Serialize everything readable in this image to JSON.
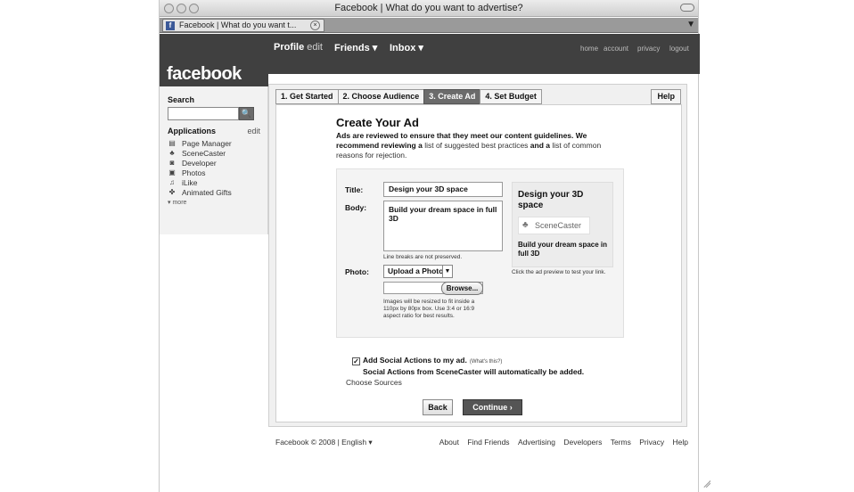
{
  "window": {
    "title": "Facebook | What do you want to advertise?"
  },
  "browser_tab": {
    "label": "Facebook | What do you want t...",
    "favicon": "f"
  },
  "sidebar": {
    "logo": "facebook",
    "search_label": "Search",
    "search_value": "",
    "apps_heading": "Applications",
    "apps_edit": "edit",
    "apps": [
      {
        "label": "Page Manager",
        "icon": "page-manager-icon"
      },
      {
        "label": "SceneCaster",
        "icon": "scenecaster-icon"
      },
      {
        "label": "Developer",
        "icon": "developer-icon"
      },
      {
        "label": "Photos",
        "icon": "photos-icon"
      },
      {
        "label": "iLike",
        "icon": "ilike-icon"
      },
      {
        "label": "Animated Gifts",
        "icon": "animated-gifts-icon"
      }
    ],
    "more": "more"
  },
  "topnav": {
    "profile": "Profile",
    "profile_edit": "edit",
    "friends": "Friends",
    "inbox": "Inbox",
    "home": "home",
    "account": "account",
    "privacy": "privacy",
    "logout": "logout"
  },
  "steps": [
    "1. Get Started",
    "2. Choose Audience",
    "3. Create Ad",
    "4. Set Budget"
  ],
  "active_step": 2,
  "help": "Help",
  "create_ad": {
    "heading": "Create Your Ad",
    "intro_a": "Ads are reviewed to ensure that they meet our content guidelines. We recommend reviewing a ",
    "intro_link1": "list of suggested best practices",
    "intro_b": " and a ",
    "intro_link2": "list of common reasons for rejection.",
    "title_label": "Title:",
    "title_value": "Design your 3D space",
    "body_label": "Body:",
    "body_value": "Build your dream space in full 3D",
    "body_hint": "Line breaks are not preserved.",
    "photo_label": "Photo:",
    "photo_select": "Upload a Photo",
    "browse": "Browse...",
    "photo_hint": "Images will be resized to fit inside a 110px by 80px box. Use 3:4 or 16:9 aspect ratio for best results.",
    "preview_title": "Design your 3D space",
    "preview_logo": "SceneCaster",
    "preview_body": "Build your dream space in full 3D",
    "preview_hint": "Click the ad preview to test your link.",
    "social_label": "Add Social Actions to my ad.",
    "social_what": "(What's this?)",
    "social_checked": true,
    "social_note": "Social Actions from SceneCaster will automatically be added.",
    "choose_sources": "Choose Sources",
    "back": "Back",
    "continue": "Continue"
  },
  "footer": {
    "copyright": "Facebook © 2008",
    "language": "English",
    "links": [
      "About",
      "Find Friends",
      "Advertising",
      "Developers",
      "Terms",
      "Privacy",
      "Help"
    ]
  }
}
